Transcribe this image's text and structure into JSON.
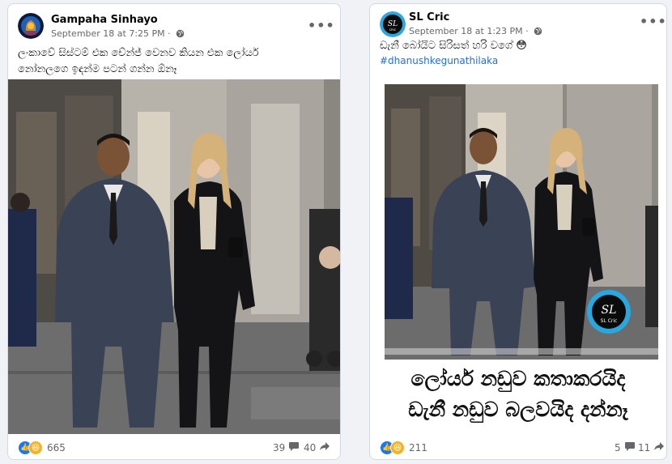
{
  "posts": [
    {
      "page_name": "Gampaha Sinhayo",
      "date": "September 18 at 7:25 PM",
      "separator": "·",
      "caption_lines": [
        "ලංකාවේ සිස්ටම් එක චේන්ජ් වෙනව කියන එක ලෝයර්",
        "නෝනලගෙ ඉඳන්ම පටන් ගන්න ඕනෑ"
      ],
      "reaction_count": "665",
      "comment_count": "39",
      "share_count": "40",
      "icons": [
        "lion-logo-avatar",
        "globe-icon",
        "more-options-icon",
        "like-reaction-icon",
        "haha-reaction-icon",
        "comment-icon",
        "share-icon"
      ]
    },
    {
      "page_name": "SL Cric",
      "date": "September 18 at 1:23 PM",
      "separator": "·",
      "caption": "ඩැනී බෝයිට සිරිසත් හරි වගේ",
      "emoji": "😳",
      "hashtag": "#dhanushkegunathilaka",
      "meme_lines": [
        "ලෝයර් නඩුව කතාකරයිද",
        "ඩැනී නඩුව බලවයිද දන්නෑ"
      ],
      "watermark": "SL Cric",
      "reaction_count": "211",
      "comment_count": "5",
      "share_count": "11",
      "icons": [
        "slcric-logo-avatar",
        "globe-icon",
        "more-options-icon",
        "like-reaction-icon",
        "haha-reaction-icon",
        "comment-icon",
        "share-icon"
      ]
    }
  ],
  "colors": {
    "page_bg": "#f0f2f5",
    "card_bg": "#ffffff",
    "link_blue": "#216fdb",
    "like_blue": "#1877f2",
    "haha_yellow": "#f7b125",
    "muted_text": "#65676b"
  }
}
